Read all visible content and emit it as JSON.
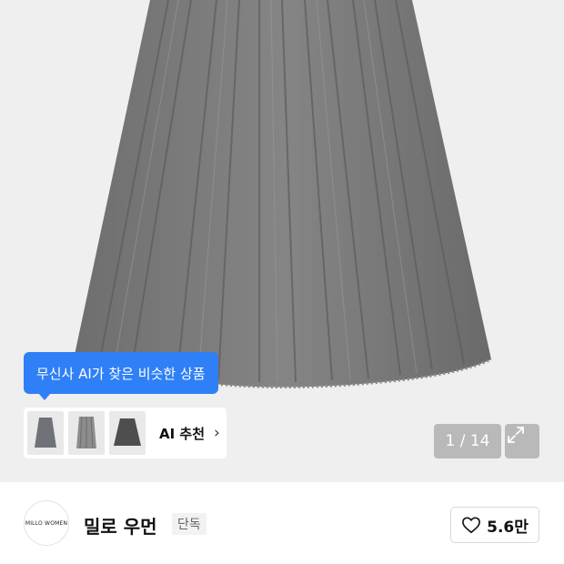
{
  "image": {
    "icon": "pleated-skirt-photo"
  },
  "ai_tooltip": {
    "text": "무신사 AI가 찾은 비슷한 상품"
  },
  "ai_recommend": {
    "label": "AI 추천",
    "chevron": "›",
    "thumbnails": [
      {
        "name": "thumb-skirt-grey-a"
      },
      {
        "name": "thumb-skirt-grey-b"
      },
      {
        "name": "thumb-skirt-dark"
      }
    ]
  },
  "gallery": {
    "counter": "1 / 14",
    "expand_icon": "expand-icon"
  },
  "brand": {
    "logo_text": "MILLO WOMEN",
    "name": "밀로 우먼",
    "badge": "단독",
    "likes": "5.6만"
  },
  "colors": {
    "accent": "#2f80f6",
    "skirt": "#7b7b7b",
    "background": "#efefef"
  }
}
